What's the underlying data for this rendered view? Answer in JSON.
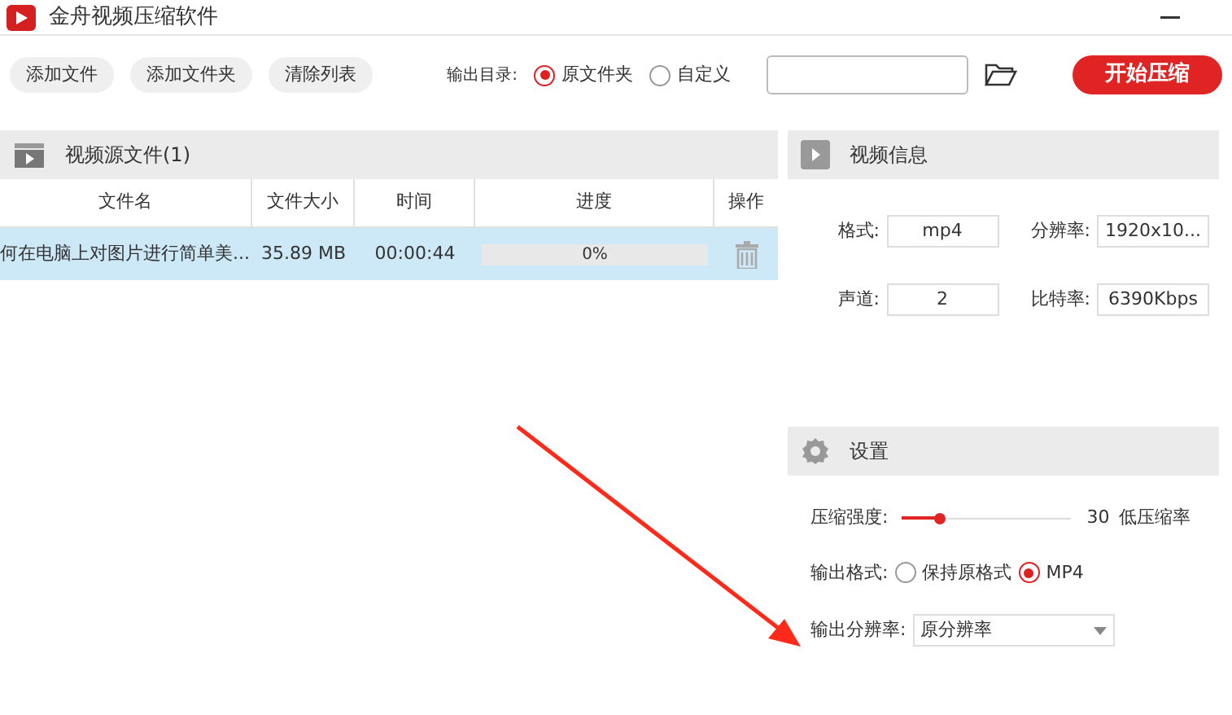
{
  "window": {
    "title": "金舟视频压缩软件"
  },
  "toolbar": {
    "buttons": [
      "添加文件",
      "添加文件夹",
      "清除列表"
    ],
    "output_dir_label": "输出目录:",
    "output_dir_options": [
      {
        "label": "原文件夹",
        "selected": true
      },
      {
        "label": "自定义",
        "selected": false
      }
    ],
    "start_button": "开始压缩"
  },
  "source_panel": {
    "title": "视频源文件(1)",
    "columns": [
      "文件名",
      "文件大小",
      "时间",
      "进度",
      "操作"
    ],
    "rows": [
      {
        "name": "何在电脑上对图片进行简单美...",
        "size": "35.89 MB",
        "duration": "00:00:44",
        "progress": "0%",
        "selected": true
      }
    ]
  },
  "info_panel": {
    "title": "视频信息",
    "fields": [
      {
        "label": "格式:",
        "value": "mp4"
      },
      {
        "label": "分辨率:",
        "value": "1920x10..."
      },
      {
        "label": "声道:",
        "value": "2"
      },
      {
        "label": "比特率:",
        "value": "6390Kbps"
      }
    ]
  },
  "settings_panel": {
    "title": "设置",
    "strength_label": "压缩强度:",
    "strength": {
      "level": 0.22,
      "value": "30",
      "note": "低压缩率"
    },
    "format_label": "输出格式:",
    "format_options": [
      {
        "label": "保持原格式",
        "selected": false
      },
      {
        "label": "MP4",
        "selected": true
      }
    ],
    "resolution_label": "输出分辨率:",
    "resolution_value": "原分辨率"
  }
}
